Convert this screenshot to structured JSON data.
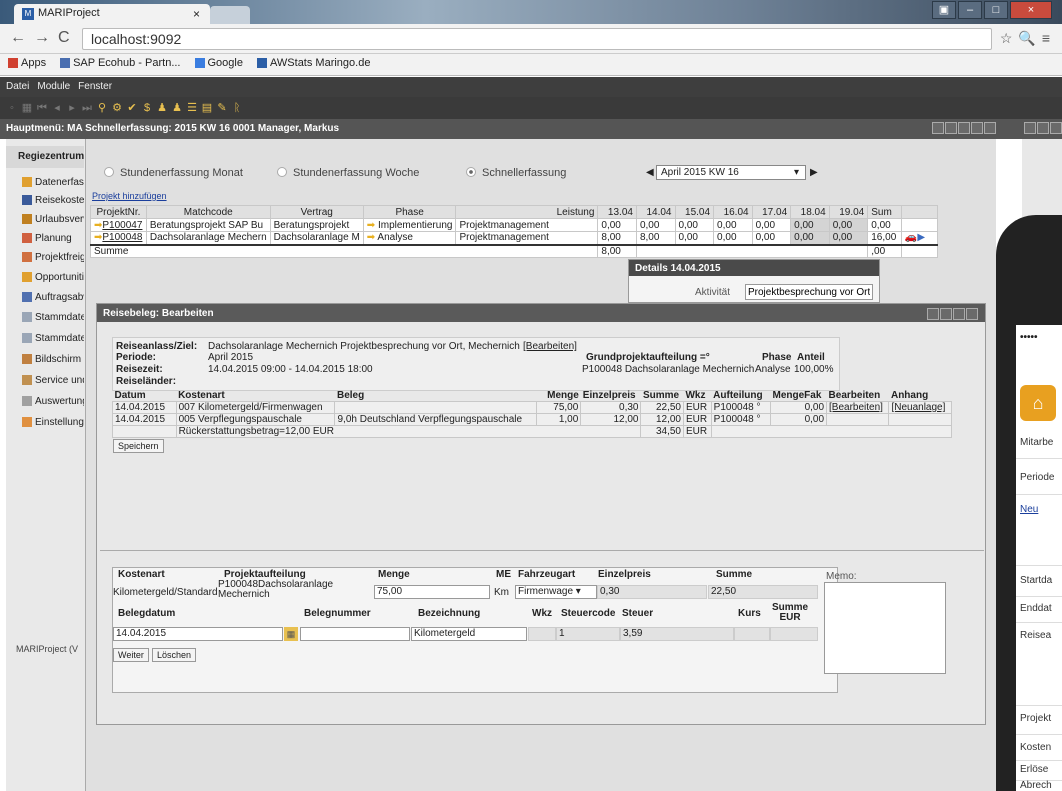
{
  "browser": {
    "tab_title": "MARIProject",
    "tab_close": "×",
    "url": "localhost:9092",
    "bookmarks": [
      {
        "label": "Apps",
        "color": "#d04030"
      },
      {
        "label": "SAP Ecohub - Partn...",
        "color": "#4a6eb0"
      },
      {
        "label": "Google",
        "color": "#3a7de0"
      },
      {
        "label": "AWStats Maringo.de",
        "color": "#2b5ea6"
      }
    ]
  },
  "menu": {
    "items": [
      "Datei",
      "Module",
      "Fenster"
    ]
  },
  "main_header": "Hauptmenü: MA Schnellerfassung: 2015 KW 16 0001 Manager, Markus",
  "sidebar": {
    "title": "Regiezentrum",
    "items": [
      "Datenerfassung",
      "Reisekosten",
      "Urlaubsverwaltung",
      "Planung",
      "Projektfreigabe",
      "Opportunities",
      "Auftragsabwicklung",
      "Stammdaten",
      "Stammdaten",
      "Bildschirm",
      "Service und",
      "Auswertungen",
      "Einstellungen"
    ],
    "footer": "MARIProject (V"
  },
  "modes": {
    "monat": "Stundenerfassung Monat",
    "woche": "Stundenerfassung Woche",
    "schnell": "Schnellerfassung",
    "selected": "schnell"
  },
  "week_select": "April 2015 KW 16",
  "add_project": "Projekt hinzufügen",
  "grid": {
    "headers": [
      "ProjektNr.",
      "Matchcode",
      "Vertrag",
      "Phase",
      "Leistung",
      "13.04",
      "14.04",
      "15.04",
      "16.04",
      "17.04",
      "18.04",
      "19.04",
      "Sum"
    ],
    "rows": [
      {
        "nr": "P100047",
        "match": "Beratungsprojekt SAP Bu",
        "vertrag": "Beratungsprojekt",
        "phase": "Implementierung",
        "leistung": "Projektmanagement",
        "d": [
          "0,00",
          "0,00",
          "0,00",
          "0,00",
          "0,00",
          "0,00",
          "0,00",
          "0,00"
        ]
      },
      {
        "nr": "P100048",
        "match": "Dachsolaranlage Mechern",
        "vertrag": "Dachsolaranlage M",
        "phase": "Analyse",
        "leistung": "Projektmanagement",
        "d": [
          "8,00",
          "8,00",
          "0,00",
          "0,00",
          "0,00",
          "0,00",
          "0,00",
          "16,00"
        ]
      }
    ],
    "sum_label": "Summe",
    "sum_first": "8,00",
    "sum_last": ",00"
  },
  "details": {
    "title": "Details 14.04.2015",
    "label": "Aktivität",
    "value": "Projektbesprechung vor Ort"
  },
  "reise": {
    "title": "Reisebeleg: Bearbeiten",
    "anlass_label": "Reiseanlass/Ziel:",
    "anlass": "Dachsolaranlage Mechernich Projektbesprechung vor Ort, Mechernich",
    "bearbeiten": "[Bearbeiten]",
    "periode_label": "Periode:",
    "periode": "April 2015",
    "reisezeit_label": "Reisezeit:",
    "reisezeit": "14.04.2015 09:00 - 14.04.2015 18:00",
    "laender_label": "Reiseländer:",
    "grund_label": "Grundprojektaufteilung =°",
    "grund": "P100048 Dachsolaranlage Mechernich",
    "phase_label": "Phase",
    "phase": "Analyse",
    "anteil_label": "Anteil",
    "anteil": "100,00%",
    "cols": [
      "Datum",
      "Kostenart",
      "Beleg",
      "Menge",
      "Einzelpreis",
      "Summe",
      "Wkz",
      "Aufteilung",
      "MengeFak",
      "Bearbeiten",
      "Anhang"
    ],
    "rows": [
      {
        "datum": "14.04.2015",
        "kostenart": "007 Kilometergeld/Firmenwagen",
        "beleg": "",
        "menge": "75,00",
        "preis": "0,30",
        "summe": "22,50",
        "wkz": "EUR",
        "auf": "P100048 °",
        "fak": "0,00",
        "bearb": "[Bearbeiten]",
        "anhang": "[Neuanlage]"
      },
      {
        "datum": "14.04.2015",
        "kostenart": "005 Verpflegungspauschale",
        "beleg": "9,0h Deutschland Verpflegungspauschale",
        "menge": "1,00",
        "preis": "12,00",
        "summe": "12,00",
        "wkz": "EUR",
        "auf": "P100048 °",
        "fak": "0,00",
        "bearb": "",
        "anhang": ""
      }
    ],
    "rueck": "Rückerstattungsbetrag=12,00 EUR",
    "total": "34,50",
    "total_wkz": "EUR",
    "speichern": "Speichern"
  },
  "lower": {
    "h_kostenart": "Kostenart",
    "h_proj": "Projektaufteilung",
    "h_menge": "Menge",
    "h_me": "ME",
    "h_fahrzeug": "Fahrzeugart",
    "h_einzel": "Einzelpreis",
    "h_summe": "Summe",
    "h_memo": "Memo:",
    "kostenart": "Kilometergeld/Standard",
    "proj": "P100048Dachsolaranlage Mechernich",
    "menge": "75,00",
    "me": "Km",
    "fahrzeug": "Firmenwage ▾",
    "einzel": "0,30",
    "summe": "22,50",
    "h_belegdatum": "Belegdatum",
    "h_belegnr": "Belegnummer",
    "h_bez": "Bezeichnung",
    "h_wkz": "Wkz",
    "h_steuercode": "Steuercode",
    "h_steuer": "Steuer",
    "h_kurs": "Kurs",
    "h_summe_eur": "Summe EUR",
    "belegdatum": "14.04.2015",
    "bez": "Kilometergeld",
    "steuercode": "1",
    "steuer": "3,59",
    "weiter": "Weiter",
    "loeschen": "Löschen"
  },
  "phone": {
    "labels": [
      "Mitarbe",
      "Periode",
      "Neu",
      "Startda",
      "Enddat",
      "Reisea",
      "Projekt",
      "Kosten",
      "Erlöse",
      "Abrech"
    ]
  }
}
